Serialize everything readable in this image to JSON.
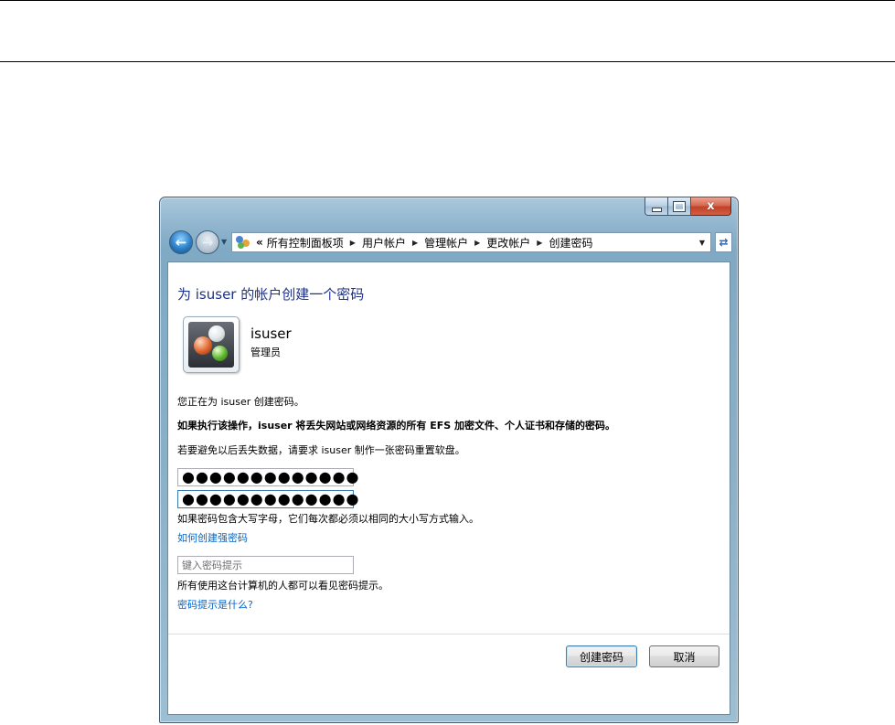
{
  "window": {
    "controls": {
      "minimize": "minimize",
      "maximize": "maximize",
      "close": "x"
    }
  },
  "nav": {
    "back_icon": "back-arrow",
    "forward_icon": "forward-arrow",
    "overflow": "«",
    "breadcrumb": [
      "所有控制面板项",
      "用户帐户",
      "管理帐户",
      "更改帐户",
      "创建密码"
    ],
    "refresh_icon": "refresh-arrows"
  },
  "page": {
    "title": "为 isuser 的帐户创建一个密码",
    "user": {
      "name": "isuser",
      "role": "管理员"
    },
    "info_line": "您正在为 isuser 创建密码。",
    "warning": "如果执行该操作，isuser 将丢失网站或网络资源的所有 EFS 加密文件、个人证书和存储的密码。",
    "advice": "若要避免以后丢失数据，请要求 isuser 制作一张密码重置软盘。",
    "password_mask": "●●●●●●●●●●●●●",
    "confirm_mask": "●●●●●●●●●●●●●",
    "case_note": "如果密码包含大写字母，它们每次都必须以相同的大小写方式输入。",
    "strong_link": "如何创建强密码",
    "hint_placeholder": "键入密码提示",
    "hint_note": "所有使用这台计算机的人都可以看见密码提示。",
    "hint_link": "密码提示是什么?"
  },
  "buttons": {
    "create": "创建密码",
    "cancel": "取消"
  },
  "colors": {
    "title": "#1e3287",
    "link": "#0066cc",
    "frame": "#8eb3cc"
  }
}
